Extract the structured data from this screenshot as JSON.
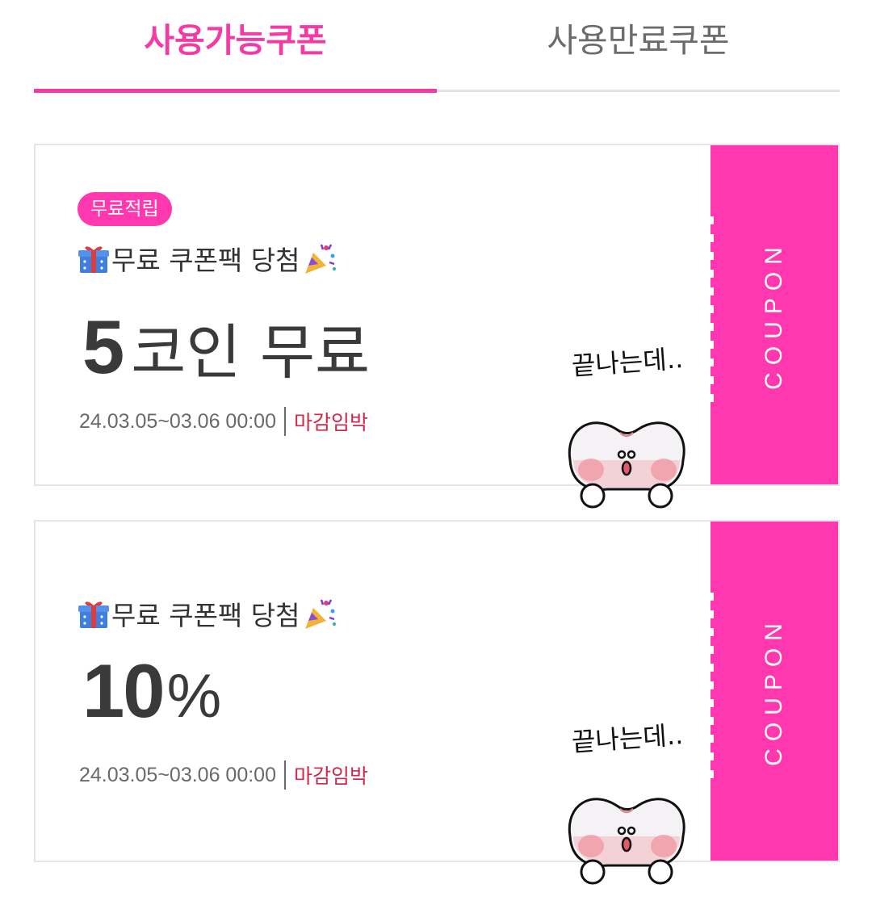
{
  "tabs": {
    "available_label": "사용가능쿠폰",
    "expired_label": "사용만료쿠폰"
  },
  "coupons": [
    {
      "badge": "무료적립",
      "title": "무료 쿠폰팩 당첨",
      "amount": "5",
      "amount_unit": "코인 무료",
      "period": "24.03.05~03.06 00:00",
      "status": "마감임박",
      "stub_label": "COUPON",
      "sticker_text": "끝나는데.."
    },
    {
      "title": "무료 쿠폰팩 당첨",
      "amount": "10",
      "amount_unit": "%",
      "period": "24.03.05~03.06 00:00",
      "status": "마감임박",
      "stub_label": "COUPON",
      "sticker_text": "끝나는데.."
    }
  ],
  "icons": {
    "title_prefix": "gift-icon",
    "title_suffix": "party-popper-icon",
    "sticker": "blob-character-sticker"
  },
  "colors": {
    "accent": "#f23ba4",
    "stub": "#ff38b0",
    "urgent": "#d0294a"
  }
}
